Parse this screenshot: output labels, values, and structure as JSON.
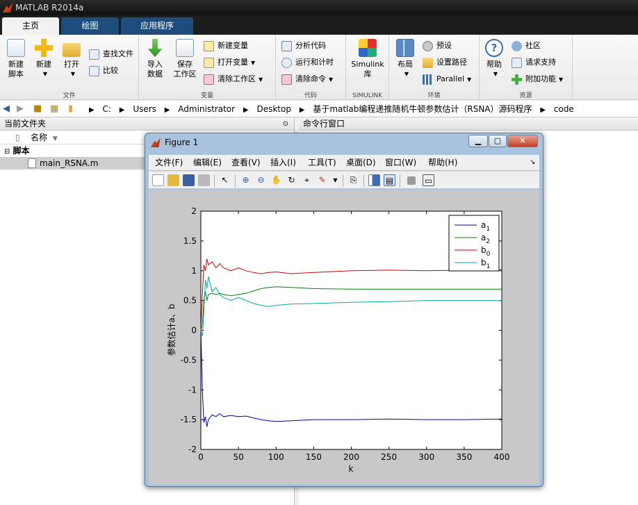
{
  "app": {
    "title": "MATLAB R2014a"
  },
  "tabs": [
    {
      "label": "主页"
    },
    {
      "label": "绘图"
    },
    {
      "label": "应用程序"
    }
  ],
  "ribbon": {
    "file_group": {
      "label": "文件",
      "new_script": "新建\n脚本",
      "new": "新建",
      "open": "打开",
      "find_files": "查找文件",
      "compare": "比较"
    },
    "variable_group": {
      "label": "变量",
      "import": "导入\n数据",
      "save_workspace": "保存\n工作区",
      "new_variable": "新建变量",
      "open_variable": "打开变量",
      "clear_workspace": "清除工作区"
    },
    "code_group": {
      "label": "代码",
      "analyze_code": "分析代码",
      "run_and_time": "运行和计时",
      "clear_commands": "清除命令"
    },
    "simulink_group": {
      "label": "SIMULINK",
      "simulink_library": "Simulink\n库"
    },
    "environment_group": {
      "label": "环境",
      "layout": "布局",
      "preferences": "预设",
      "set_path": "设置路径",
      "parallel": "Parallel"
    },
    "resources_group": {
      "label": "资源",
      "help": "帮助",
      "community": "社区",
      "request_support": "请求支持",
      "add_ons": "附加功能"
    }
  },
  "address": {
    "crumbs": [
      "C:",
      "Users",
      "Administrator",
      "Desktop",
      "基于matlab编程递推随机牛顿参数估计（RSNA）源码程序",
      "code"
    ]
  },
  "current_folder": {
    "title": "当前文件夹",
    "column_name": "名称",
    "group": "脚本",
    "files": [
      "main_RSNA.m"
    ]
  },
  "command_window": {
    "title": "命令行窗口"
  },
  "figure": {
    "title": "Figure 1",
    "menus": [
      "文件(F)",
      "编辑(E)",
      "查看(V)",
      "插入(I)",
      "工具(T)",
      "桌面(D)",
      "窗口(W)",
      "帮助(H)"
    ]
  },
  "chart_data": {
    "type": "line",
    "title": "",
    "xlabel": "k",
    "ylabel": "参数估计a、b",
    "xlim": [
      0,
      400
    ],
    "ylim": [
      -2,
      2
    ],
    "xticks": [
      0,
      50,
      100,
      150,
      200,
      250,
      300,
      350,
      400
    ],
    "yticks": [
      -2,
      -1.5,
      -1,
      -0.5,
      0,
      0.5,
      1,
      1.5,
      2
    ],
    "grid": false,
    "legend_position": "top-right",
    "series": [
      {
        "name": "a",
        "sub": "1",
        "color": "#0000aa",
        "x": [
          0,
          2,
          4,
          6,
          8,
          10,
          15,
          20,
          25,
          30,
          40,
          50,
          60,
          70,
          80,
          90,
          100,
          120,
          150,
          200,
          250,
          300,
          350,
          400
        ],
        "y": [
          0,
          -1.0,
          -1.55,
          -1.45,
          -1.62,
          -1.5,
          -1.42,
          -1.45,
          -1.4,
          -1.45,
          -1.43,
          -1.45,
          -1.44,
          -1.47,
          -1.5,
          -1.52,
          -1.53,
          -1.52,
          -1.5,
          -1.5,
          -1.49,
          -1.5,
          -1.5,
          -1.49
        ]
      },
      {
        "name": "a",
        "sub": "2",
        "color": "#008800",
        "x": [
          0,
          2,
          4,
          6,
          8,
          10,
          15,
          20,
          25,
          30,
          40,
          50,
          60,
          70,
          80,
          90,
          100,
          120,
          150,
          200,
          250,
          300,
          350,
          400
        ],
        "y": [
          0,
          0.1,
          0.5,
          0.65,
          0.5,
          0.6,
          0.62,
          0.6,
          0.62,
          0.6,
          0.58,
          0.6,
          0.62,
          0.66,
          0.7,
          0.72,
          0.73,
          0.72,
          0.7,
          0.69,
          0.69,
          0.69,
          0.69,
          0.69
        ]
      },
      {
        "name": "b",
        "sub": "0",
        "color": "#cc0000",
        "x": [
          0,
          2,
          4,
          6,
          8,
          10,
          15,
          20,
          25,
          30,
          40,
          50,
          60,
          70,
          80,
          90,
          100,
          120,
          150,
          200,
          250,
          300,
          350,
          400
        ],
        "y": [
          0,
          0.6,
          1.1,
          1.0,
          1.2,
          1.1,
          1.15,
          1.05,
          1.12,
          1.05,
          1.0,
          1.05,
          1.0,
          0.97,
          0.95,
          0.97,
          0.98,
          0.95,
          0.97,
          1.0,
          1.01,
          1.0,
          1.01,
          1.02
        ]
      },
      {
        "name": "b",
        "sub": "1",
        "color": "#00aaaa",
        "x": [
          0,
          2,
          4,
          6,
          8,
          10,
          15,
          20,
          25,
          30,
          40,
          50,
          60,
          70,
          80,
          90,
          100,
          120,
          150,
          200,
          250,
          300,
          350,
          400
        ],
        "y": [
          0,
          -0.1,
          0.3,
          0.85,
          0.7,
          0.9,
          0.65,
          0.72,
          0.6,
          0.55,
          0.5,
          0.55,
          0.5,
          0.45,
          0.42,
          0.4,
          0.42,
          0.44,
          0.45,
          0.47,
          0.48,
          0.5,
          0.5,
          0.5
        ]
      }
    ]
  }
}
